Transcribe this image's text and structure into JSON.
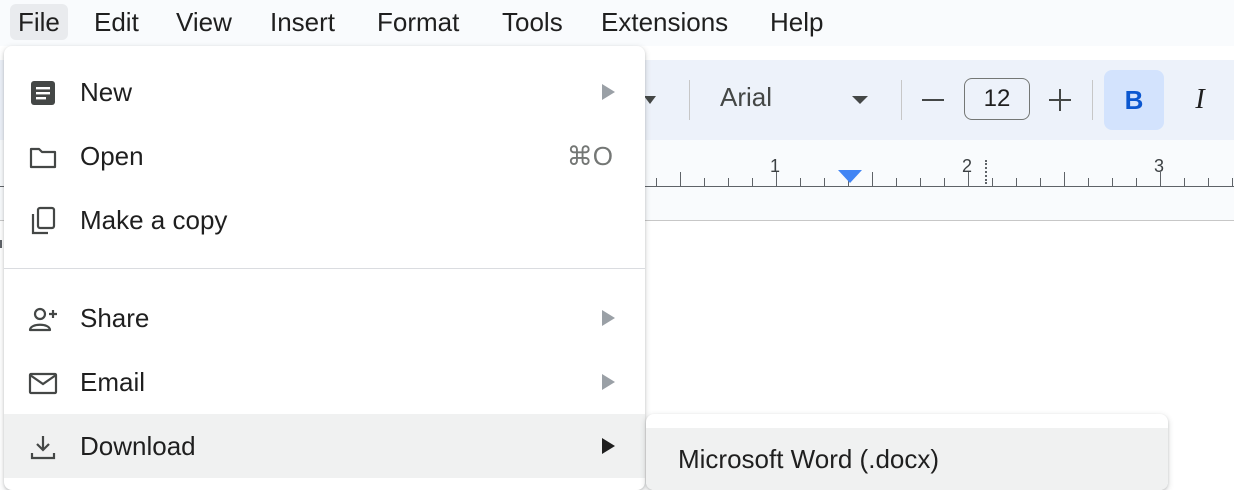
{
  "menubar": {
    "items": [
      "File",
      "Edit",
      "View",
      "Insert",
      "Format",
      "Tools",
      "Extensions",
      "Help"
    ],
    "active": "File"
  },
  "toolbar": {
    "font_name": "Arial",
    "font_size": "12",
    "bold_label": "B",
    "italic_label": "I"
  },
  "ruler": {
    "labels": [
      "1",
      "2",
      "3"
    ]
  },
  "file_menu": {
    "items": [
      {
        "label": "New",
        "icon": "document-icon",
        "has_submenu": true
      },
      {
        "label": "Open",
        "icon": "folder-icon",
        "shortcut": "⌘O"
      },
      {
        "label": "Make a copy",
        "icon": "copy-icon"
      },
      {
        "label": "Share",
        "icon": "person-add-icon",
        "has_submenu": true
      },
      {
        "label": "Email",
        "icon": "mail-icon",
        "has_submenu": true
      },
      {
        "label": "Download",
        "icon": "download-icon",
        "has_submenu": true,
        "highlighted": true
      }
    ]
  },
  "download_submenu": {
    "items": [
      "Microsoft Word (.docx)"
    ]
  },
  "colors": {
    "accent": "#0b57d0",
    "bold_bg": "#d3e3fd",
    "toolbar_bg": "#edf2fa",
    "indent_marker": "#4285f4"
  }
}
